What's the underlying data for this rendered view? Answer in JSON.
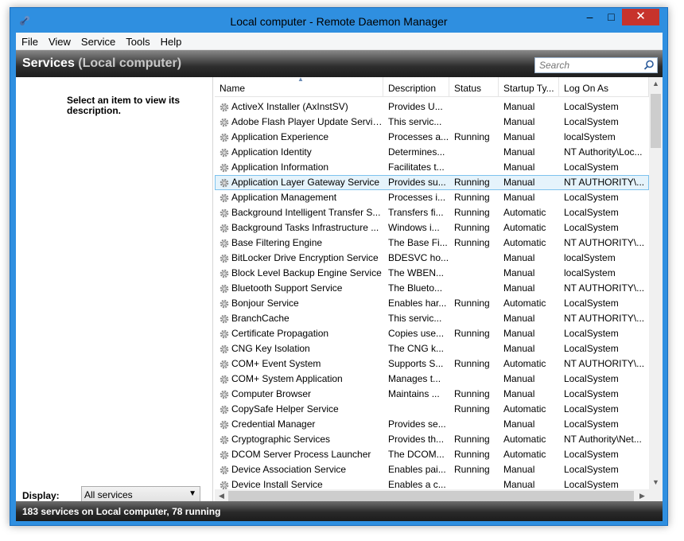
{
  "window": {
    "title": "Local computer - Remote Daemon Manager",
    "minimize_glyph": "–",
    "maximize_glyph": "□",
    "close_glyph": "✕"
  },
  "menu": [
    "File",
    "View",
    "Service",
    "Tools",
    "Help"
  ],
  "header": {
    "title_main": "Services",
    "title_open": " (",
    "title_sub": "Local computer",
    "title_close": ")"
  },
  "search": {
    "placeholder": "Search"
  },
  "left_panel": {
    "description": "Select an item to view its description.",
    "display_label": "Display:",
    "display_value": "All services"
  },
  "columns": [
    "Name",
    "Description",
    "Status",
    "Startup Ty...",
    "Log On As"
  ],
  "rows": [
    {
      "name": "ActiveX Installer (AxInstSV)",
      "description": "Provides U...",
      "status": "",
      "startup": "Manual",
      "logon": "LocalSystem"
    },
    {
      "name": "Adobe Flash Player Update Service",
      "description": "This servic...",
      "status": "",
      "startup": "Manual",
      "logon": "LocalSystem"
    },
    {
      "name": "Application Experience",
      "description": "Processes a...",
      "status": "Running",
      "startup": "Manual",
      "logon": "localSystem"
    },
    {
      "name": "Application Identity",
      "description": "Determines...",
      "status": "",
      "startup": "Manual",
      "logon": "NT Authority\\Loc..."
    },
    {
      "name": "Application Information",
      "description": "Facilitates t...",
      "status": "",
      "startup": "Manual",
      "logon": "LocalSystem"
    },
    {
      "name": "Application Layer Gateway Service",
      "description": "Provides su...",
      "status": "Running",
      "startup": "Manual",
      "logon": "NT AUTHORITY\\..."
    },
    {
      "name": "Application Management",
      "description": "Processes i...",
      "status": "Running",
      "startup": "Manual",
      "logon": "LocalSystem"
    },
    {
      "name": "Background Intelligent Transfer S...",
      "description": "Transfers fi...",
      "status": "Running",
      "startup": "Automatic",
      "logon": "LocalSystem"
    },
    {
      "name": "Background Tasks Infrastructure ...",
      "description": "Windows i...",
      "status": "Running",
      "startup": "Automatic",
      "logon": "LocalSystem"
    },
    {
      "name": "Base Filtering Engine",
      "description": "The Base Fi...",
      "status": "Running",
      "startup": "Automatic",
      "logon": "NT AUTHORITY\\..."
    },
    {
      "name": "BitLocker Drive Encryption Service",
      "description": "BDESVC ho...",
      "status": "",
      "startup": "Manual",
      "logon": "localSystem"
    },
    {
      "name": "Block Level Backup Engine Service",
      "description": "The WBEN...",
      "status": "",
      "startup": "Manual",
      "logon": "localSystem"
    },
    {
      "name": "Bluetooth Support Service",
      "description": "The Blueto...",
      "status": "",
      "startup": "Manual",
      "logon": "NT AUTHORITY\\..."
    },
    {
      "name": "Bonjour Service",
      "description": "Enables har...",
      "status": "Running",
      "startup": "Automatic",
      "logon": "LocalSystem"
    },
    {
      "name": "BranchCache",
      "description": "This servic...",
      "status": "",
      "startup": "Manual",
      "logon": "NT AUTHORITY\\..."
    },
    {
      "name": "Certificate Propagation",
      "description": "Copies use...",
      "status": "Running",
      "startup": "Manual",
      "logon": "LocalSystem"
    },
    {
      "name": "CNG Key Isolation",
      "description": "The CNG k...",
      "status": "",
      "startup": "Manual",
      "logon": "LocalSystem"
    },
    {
      "name": "COM+ Event System",
      "description": "Supports S...",
      "status": "Running",
      "startup": "Automatic",
      "logon": "NT AUTHORITY\\..."
    },
    {
      "name": "COM+ System Application",
      "description": "Manages t...",
      "status": "",
      "startup": "Manual",
      "logon": "LocalSystem"
    },
    {
      "name": "Computer Browser",
      "description": "Maintains ...",
      "status": "Running",
      "startup": "Manual",
      "logon": "LocalSystem"
    },
    {
      "name": "CopySafe Helper Service",
      "description": "",
      "status": "Running",
      "startup": "Automatic",
      "logon": "LocalSystem"
    },
    {
      "name": "Credential Manager",
      "description": "Provides se...",
      "status": "",
      "startup": "Manual",
      "logon": "LocalSystem"
    },
    {
      "name": "Cryptographic Services",
      "description": "Provides th...",
      "status": "Running",
      "startup": "Automatic",
      "logon": "NT Authority\\Net..."
    },
    {
      "name": "DCOM Server Process Launcher",
      "description": "The DCOM...",
      "status": "Running",
      "startup": "Automatic",
      "logon": "LocalSystem"
    },
    {
      "name": "Device Association Service",
      "description": "Enables pai...",
      "status": "Running",
      "startup": "Manual",
      "logon": "LocalSystem"
    },
    {
      "name": "Device Install Service",
      "description": "Enables a c...",
      "status": "",
      "startup": "Manual",
      "logon": "LocalSystem"
    }
  ],
  "selected_row": 5,
  "status_bar": "183 services on Local computer, 78 running",
  "colors": {
    "frame": "#2f8fe0",
    "close_button": "#c7332c",
    "selection": "#e5f3fb",
    "header_dark": "#1e1e1e"
  },
  "icons": [
    "app-icon",
    "search-icon",
    "gear-icon",
    "chevron-down-icon",
    "scroll-up-icon",
    "scroll-down-icon",
    "scroll-left-icon",
    "scroll-right-icon"
  ]
}
